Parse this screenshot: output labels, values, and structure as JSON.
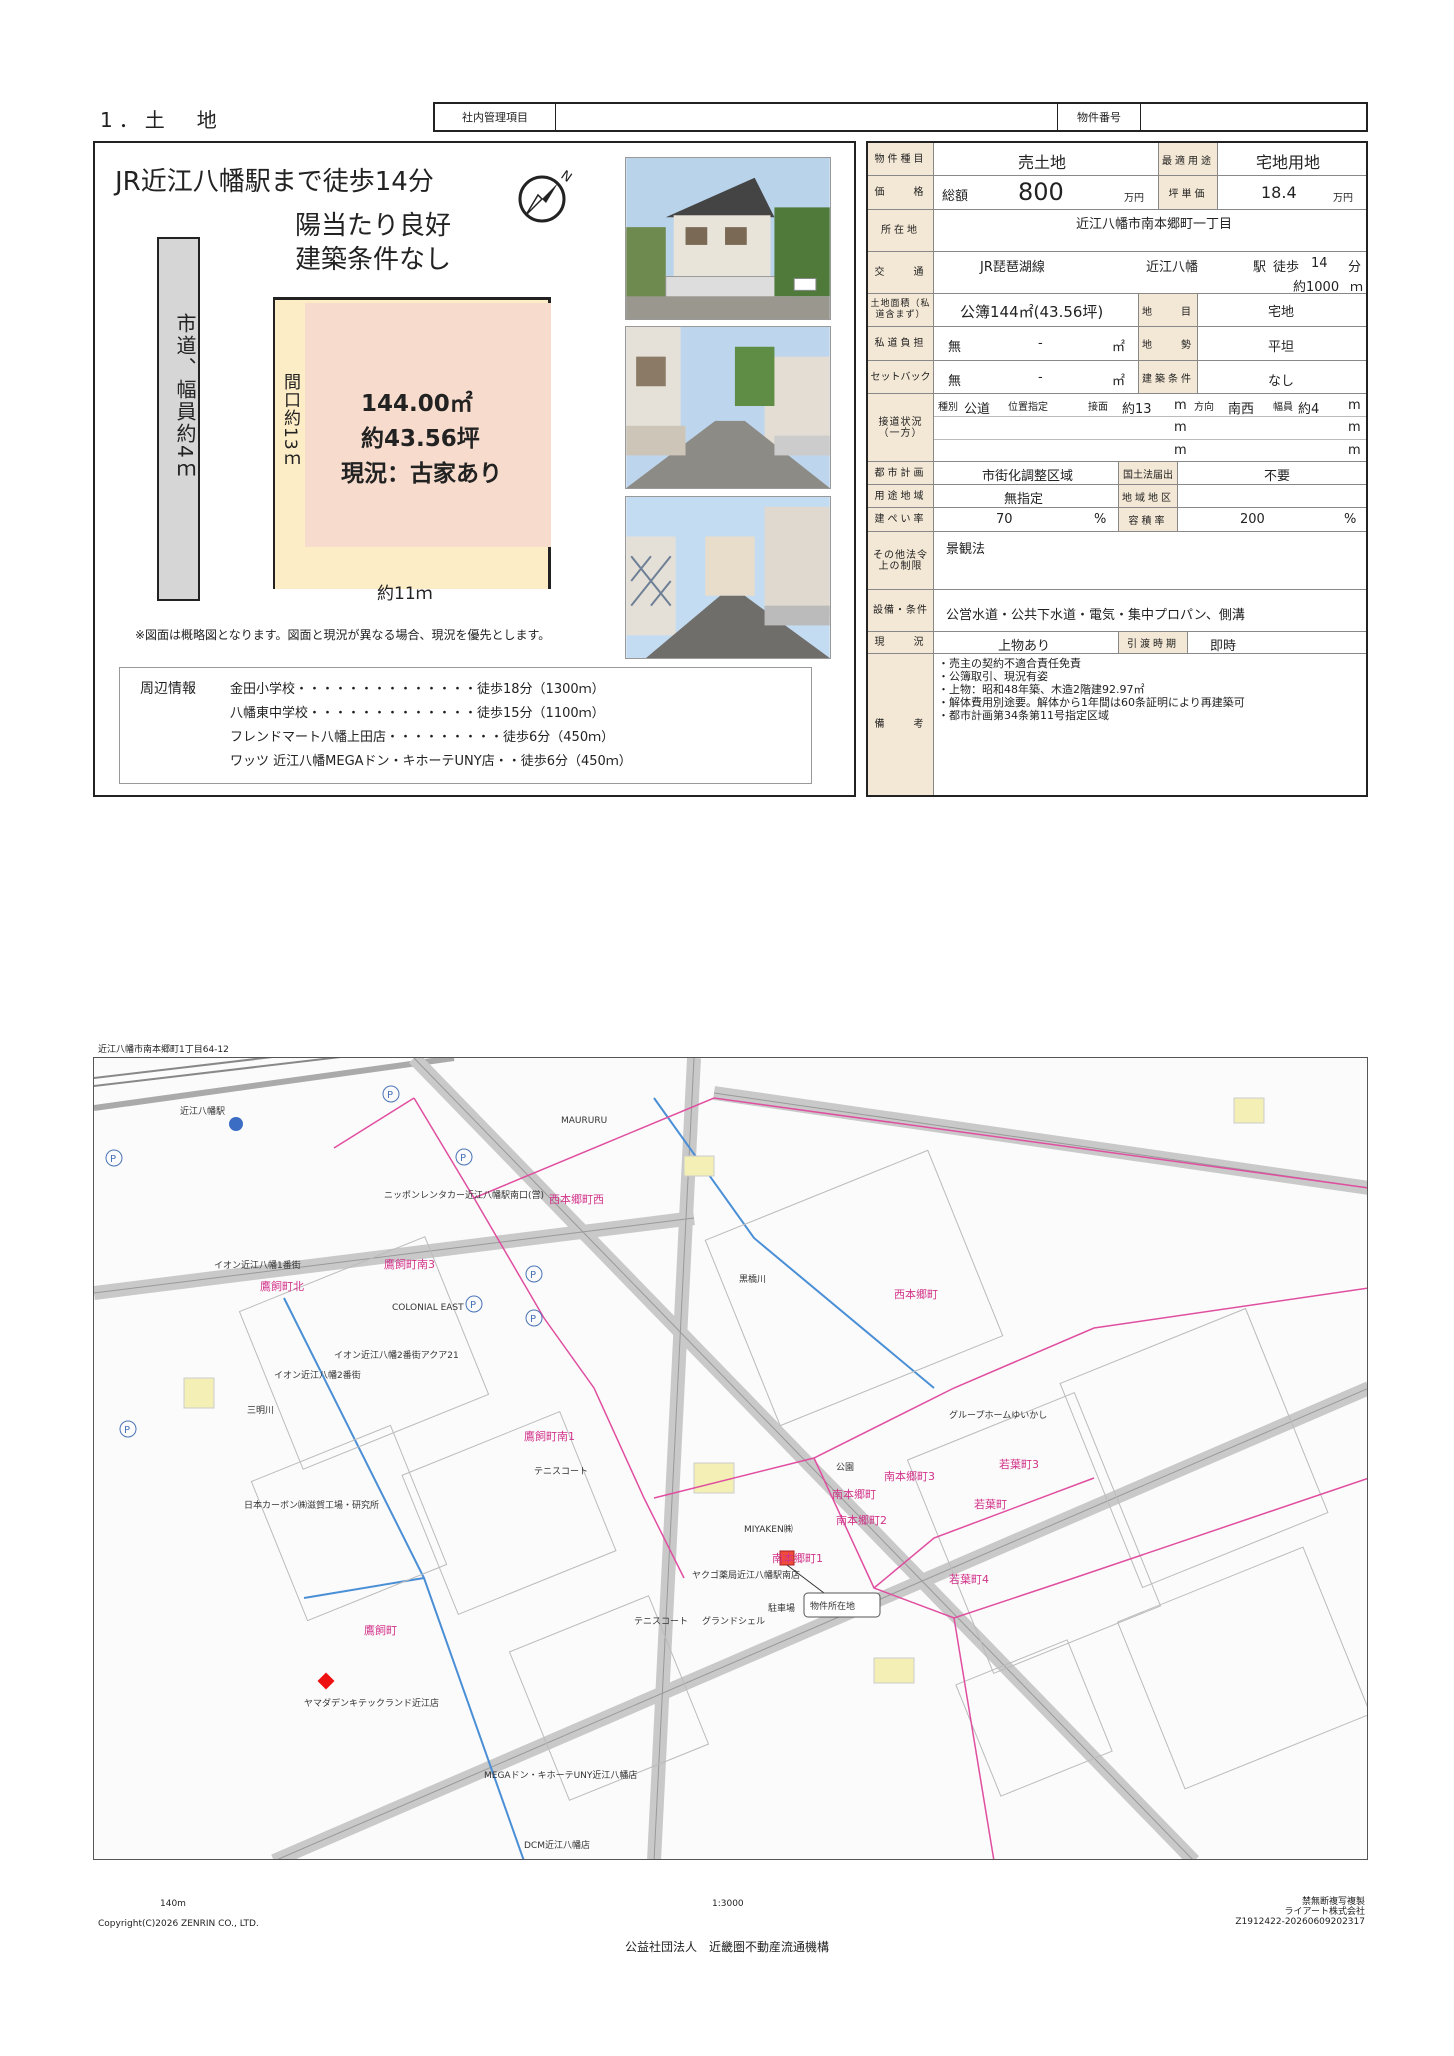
{
  "header": {
    "section_title": "1．土　地",
    "mgmt_label": "社内管理項目",
    "property_no_label": "物件番号"
  },
  "left": {
    "headline1": "JR近江八幡駅まで徒歩14分",
    "headline2": "陽当たり良好",
    "headline3": "建築条件なし",
    "road_label": "市道、幅員約4ｍ",
    "frontage_label": "間口約13ｍ",
    "area_m2": "144.00㎡",
    "area_tsubo": "約43.56坪",
    "current_status": "現況：古家あり",
    "width_label": "約11ｍ",
    "note": "※図面は概略図となります。図面と現況が異なる場合、現況を優先とします。",
    "nearby_label": "周辺情報",
    "nearby": [
      "金田小学校・・・・・・・・・・・・・・徒歩18分（1300ｍ）",
      "八幡東中学校・・・・・・・・・・・・・徒歩15分（1100ｍ）",
      "フレンドマート八幡上田店・・・・・・・・・徒歩6分（450ｍ）",
      "ワッツ 近江八幡MEGAドン・キホーテUNY店・・徒歩6分（450ｍ）"
    ]
  },
  "table": {
    "type_label": "物件種目",
    "type_value": "売土地",
    "best_use_label": "最適用途",
    "best_use_value": "宅地用地",
    "price_label": "価　　格",
    "price_total_label": "総額",
    "price_value": "800",
    "price_unit": "万円",
    "tsubo_price_label": "坪単価",
    "tsubo_price_value": "18.4",
    "tsubo_price_unit": "万円",
    "location_label": "所在地",
    "location_value": "近江八幡市南本郷町一丁目",
    "transport_label": "交　　通",
    "line": "JR琵琶湖線",
    "station": "近江八幡",
    "station_suffix": "駅",
    "walk_label": "徒歩",
    "walk_min": "14",
    "walk_unit": "分",
    "distance": "約1000",
    "distance_unit": "ｍ",
    "land_area_label": "土地面積（私道含まず）",
    "land_area_value": "公簿144㎡(43.56坪)",
    "chimoku_label": "地　　目",
    "chimoku_value": "宅地",
    "private_road_label": "私道負担",
    "private_road_value": "無",
    "private_road_dash": "-",
    "sqm": "㎡",
    "terrain_label": "地　　勢",
    "terrain_value": "平坦",
    "setback_label": "セットバック",
    "setback_value": "無",
    "setback_dash": "-",
    "build_cond_label": "建築条件",
    "build_cond_value": "なし",
    "road_contact_label": "接道状況（一方）",
    "road_kind_label": "種別",
    "road_kind_value": "公道",
    "road_pos_label": "位置指定",
    "road_contact_len_label": "接面",
    "road_contact_len_value": "約13",
    "m": "m",
    "road_dir_label": "方向",
    "road_dir_value": "南西",
    "road_width_label": "幅員",
    "road_width_value": "約4",
    "city_plan_label": "都市計画",
    "city_plan_value": "市街化調整区域",
    "kokudo_label": "国土法届出",
    "kokudo_value": "不要",
    "zoning_label": "用途地域",
    "zoning_value": "無指定",
    "district_label": "地域地区",
    "bcr_label": "建ぺい率",
    "bcr_value": "70",
    "far_label": "容積率",
    "far_value": "200",
    "pct": "%",
    "other_label": "その他法令上の制限",
    "other_value": "景観法",
    "facilities_label": "設備・条件",
    "facilities_value": "公営水道・公共下水道・電気・集中プロパン、側溝",
    "status_label": "現　　況",
    "status_value": "上物あり",
    "handover_label": "引渡時期",
    "handover_value": "即時",
    "remarks_label": "備　　考",
    "remarks": [
      "・売主の契約不適合責任免責",
      "・公簿取引、現況有姿",
      "・上物：昭和48年築、木造2階建92.97㎡",
      "・解体費用別途要。解体から1年間は60条証明により再建築可",
      "・都市計画第34条第11号指定区域"
    ]
  },
  "map": {
    "address": "近江八幡市南本郷町1丁目64-12",
    "marker_label": "物件所在地",
    "scale_label": "140m",
    "scale_ratio": "1:3000",
    "copyright": "Copyright(C)2026 ZENRIN CO., LTD.",
    "credit1": "禁無断複写複製",
    "credit2": "ライアート株式会社",
    "credit3": "Z1912422-20260609202317",
    "labels": {
      "station": "近江八幡駅",
      "aeon1": "イオン近江八幡1番街",
      "aeon2": "イオン近江八幡2番街",
      "aeon21": "イオン近江八幡2番街アクア21",
      "nihon_carbon": "日本カーボン㈱滋賀工場・研究所",
      "mega": "MEGAドン・キホーテUNY近江八幡店",
      "yamada": "ヤマダデンキテックランド近江店",
      "dcm": "DCM近江八幡店",
      "takagai": "鷹飼町",
      "takagai_minami3": "鷹飼町南3",
      "takagai_minami1": "鷹飼町南1",
      "takagai_kita": "鷹飼町北",
      "nishi_hongo_nishi": "西本郷町西",
      "nishi_hongo": "西本郷町",
      "minami_hongo": "南本郷町",
      "minami_hongo1": "南本郷町1",
      "minami_hongo2": "南本郷町2",
      "minami_hongo3": "南本郷町3",
      "wakaba": "若葉町",
      "wakaba3": "若葉町3",
      "wakaba4": "若葉町4",
      "shimanogawa": "黒橋川",
      "mitsuya": "三明川",
      "colonial": "COLONIAL EAST",
      "mauruuru": "MAURURU",
      "grand_shell": "グランドシェル",
      "miyaken": "MIYAKEN㈱",
      "tennis1": "テニスコート",
      "tennis2": "テニスコート",
      "parking": "駐車場",
      "koen": "公園",
      "group_home": "グループホームゆいかし",
      "yakuzaikyoku": "ヤクゴ薬局近江八幡駅南店",
      "nippon_rent": "ニッポンレンタカー近江八幡駅南口(営)"
    }
  }
}
